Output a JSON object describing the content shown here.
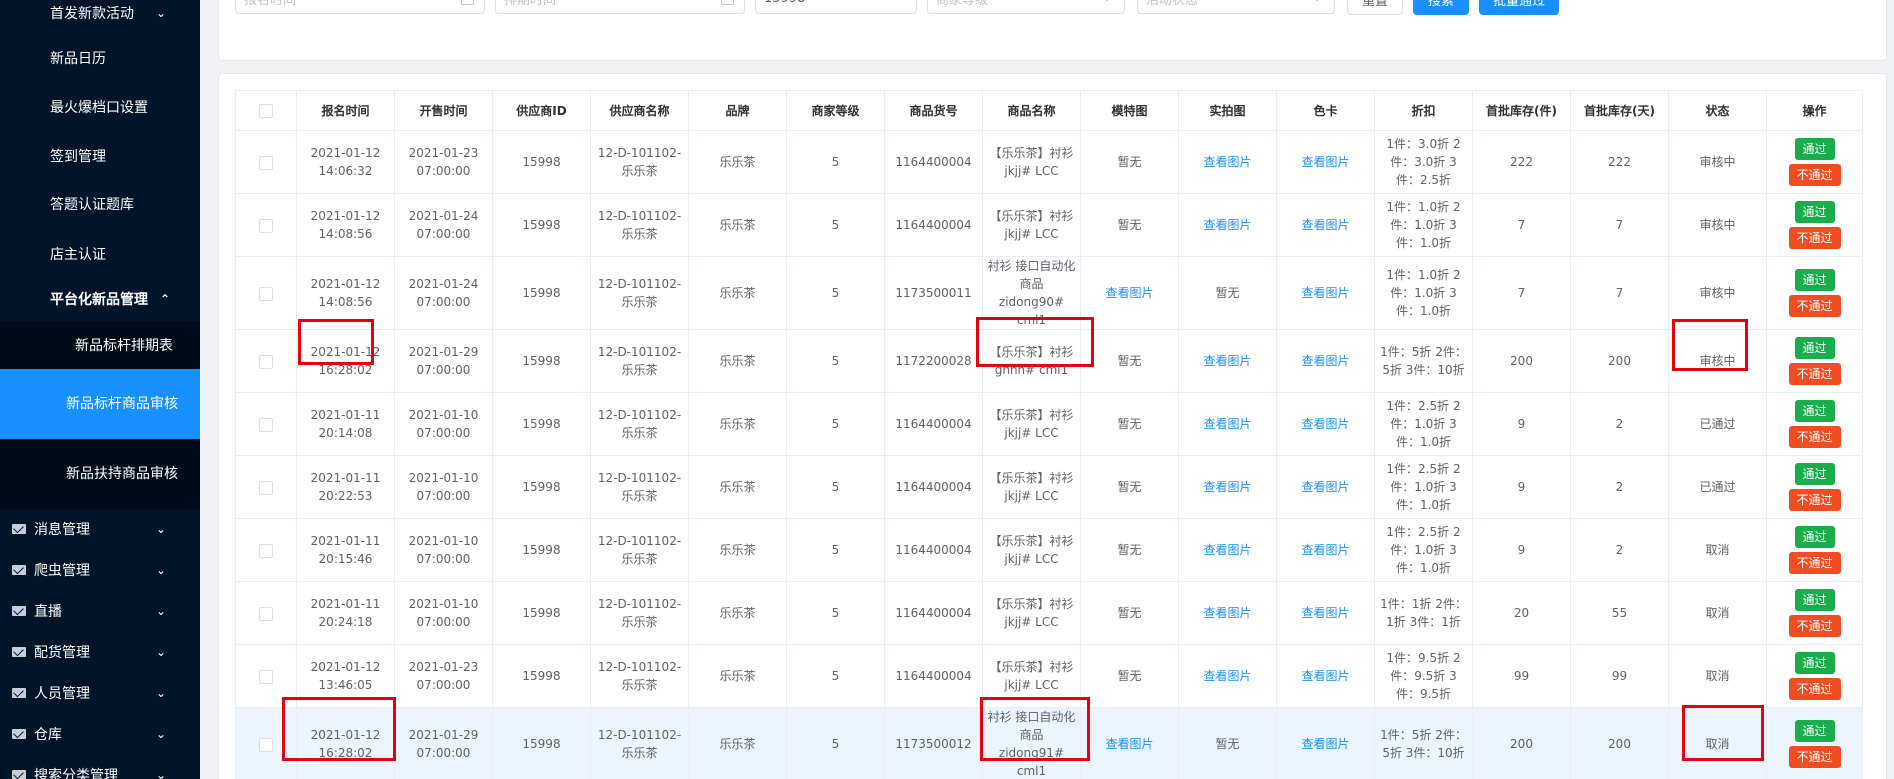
{
  "sidebar": {
    "items": [
      {
        "label": "首发新款活动",
        "chevron": "⌄"
      },
      {
        "label": "新品日历"
      },
      {
        "label": "最火爆档口设置"
      },
      {
        "label": "签到管理"
      },
      {
        "label": "答题认证题库"
      },
      {
        "label": "店主认证"
      },
      {
        "label": "平台化新品管理",
        "chevron": "⌃"
      },
      {
        "label": "新品标杆排期表"
      },
      {
        "label": "新品标杆商品审核"
      },
      {
        "label": "新品扶持商品审核"
      },
      {
        "label": "消息管理",
        "chevron": "⌄"
      },
      {
        "label": "爬虫管理",
        "chevron": "⌄"
      },
      {
        "label": "直播",
        "chevron": "⌄"
      },
      {
        "label": "配货管理",
        "chevron": "⌄"
      },
      {
        "label": "人员管理",
        "chevron": "⌄"
      },
      {
        "label": "仓库",
        "chevron": "⌄"
      },
      {
        "label": "搜索分类管理",
        "chevron": "⌄"
      }
    ]
  },
  "filters": {
    "signup_time_placeholder": "报名时间",
    "schedule_time_placeholder": "排期时间",
    "supplier_id_value": "15998",
    "merchant_level_placeholder": "商家等级",
    "activity_status_placeholder": "活动状态",
    "reset_label": "重置",
    "search_label": "搜索",
    "batch_pass_label": "批量通过"
  },
  "table": {
    "headers": [
      "报名时间",
      "开售时间",
      "供应商ID",
      "供应商名称",
      "品牌",
      "商家等级",
      "商品货号",
      "商品名称",
      "模特图",
      "实拍图",
      "色卡",
      "折扣",
      "首批库存(件)",
      "首批库存(天)",
      "状态",
      "操作"
    ],
    "pass_label": "通过",
    "fail_label": "不通过",
    "rows": [
      {
        "signup": "2021-01-12 14:06:32",
        "sale": "2021-01-23 07:00:00",
        "sid": "15998",
        "sname": "12-D-101102-乐乐茶",
        "brand": "乐乐茶",
        "level": "5",
        "sku": "1164400004",
        "pname": "【乐乐茶】衬衫jkjj# LCC",
        "model": "暂无",
        "real": "查看图片",
        "color": "查看图片",
        "discount": "1件：3.0折 2件：3.0折 3件：2.5折",
        "stock_qty": "222",
        "stock_days": "222",
        "status": "审核中"
      },
      {
        "signup": "2021-01-12 14:08:56",
        "sale": "2021-01-24 07:00:00",
        "sid": "15998",
        "sname": "12-D-101102-乐乐茶",
        "brand": "乐乐茶",
        "level": "5",
        "sku": "1164400004",
        "pname": "【乐乐茶】衬衫jkjj# LCC",
        "model": "暂无",
        "real": "查看图片",
        "color": "查看图片",
        "discount": "1件：1.0折 2件：1.0折 3件：1.0折",
        "stock_qty": "7",
        "stock_days": "7",
        "status": "审核中"
      },
      {
        "signup": "2021-01-12 14:08:56",
        "sale": "2021-01-24 07:00:00",
        "sid": "15998",
        "sname": "12-D-101102-乐乐茶",
        "brand": "乐乐茶",
        "level": "5",
        "sku": "1173500011",
        "pname": "衬衫 接口自动化商品 zidong90# cml1",
        "model": "查看图片",
        "real": "暂无",
        "color": "查看图片",
        "discount": "1件：1.0折 2件：1.0折 3件：1.0折",
        "stock_qty": "7",
        "stock_days": "7",
        "status": "审核中"
      },
      {
        "signup": "2021-01-12 16:28:02",
        "sale": "2021-01-29 07:00:00",
        "sid": "15998",
        "sname": "12-D-101102-乐乐茶",
        "brand": "乐乐茶",
        "level": "5",
        "sku": "1172200028",
        "pname": "【乐乐茶】衬衫gnnn# cml1",
        "model": "暂无",
        "real": "查看图片",
        "color": "查看图片",
        "discount": "1件：5折 2件：5折 3件：10折",
        "stock_qty": "200",
        "stock_days": "200",
        "status": "审核中"
      },
      {
        "signup": "2021-01-11 20:14:08",
        "sale": "2021-01-10 07:00:00",
        "sid": "15998",
        "sname": "12-D-101102-乐乐茶",
        "brand": "乐乐茶",
        "level": "5",
        "sku": "1164400004",
        "pname": "【乐乐茶】衬衫jkjj# LCC",
        "model": "暂无",
        "real": "查看图片",
        "color": "查看图片",
        "discount": "1件：2.5折 2件：1.0折 3件：1.0折",
        "stock_qty": "9",
        "stock_days": "2",
        "status": "已通过"
      },
      {
        "signup": "2021-01-11 20:22:53",
        "sale": "2021-01-10 07:00:00",
        "sid": "15998",
        "sname": "12-D-101102-乐乐茶",
        "brand": "乐乐茶",
        "level": "5",
        "sku": "1164400004",
        "pname": "【乐乐茶】衬衫jkjj# LCC",
        "model": "暂无",
        "real": "查看图片",
        "color": "查看图片",
        "discount": "1件：2.5折 2件：1.0折 3件：1.0折",
        "stock_qty": "9",
        "stock_days": "2",
        "status": "已通过"
      },
      {
        "signup": "2021-01-11 20:15:46",
        "sale": "2021-01-10 07:00:00",
        "sid": "15998",
        "sname": "12-D-101102-乐乐茶",
        "brand": "乐乐茶",
        "level": "5",
        "sku": "1164400004",
        "pname": "【乐乐茶】衬衫jkjj# LCC",
        "model": "暂无",
        "real": "查看图片",
        "color": "查看图片",
        "discount": "1件：2.5折 2件：1.0折 3件：1.0折",
        "stock_qty": "9",
        "stock_days": "2",
        "status": "取消"
      },
      {
        "signup": "2021-01-11 20:24:18",
        "sale": "2021-01-10 07:00:00",
        "sid": "15998",
        "sname": "12-D-101102-乐乐茶",
        "brand": "乐乐茶",
        "level": "5",
        "sku": "1164400004",
        "pname": "【乐乐茶】衬衫jkjj# LCC",
        "model": "暂无",
        "real": "查看图片",
        "color": "查看图片",
        "discount": "1件：1折 2件：1折 3件：1折",
        "stock_qty": "20",
        "stock_days": "55",
        "status": "取消"
      },
      {
        "signup": "2021-01-12 13:46:05",
        "sale": "2021-01-23 07:00:00",
        "sid": "15998",
        "sname": "12-D-101102-乐乐茶",
        "brand": "乐乐茶",
        "level": "5",
        "sku": "1164400004",
        "pname": "【乐乐茶】衬衫jkjj# LCC",
        "model": "暂无",
        "real": "查看图片",
        "color": "查看图片",
        "discount": "1件：9.5折 2件：9.5折 3件：9.5折",
        "stock_qty": "99",
        "stock_days": "99",
        "status": "取消"
      },
      {
        "signup": "2021-01-12 16:28:02",
        "sale": "2021-01-29 07:00:00",
        "sid": "15998",
        "sname": "12-D-101102-乐乐茶",
        "brand": "乐乐茶",
        "level": "5",
        "sku": "1173500012",
        "pname": "衬衫 接口自动化商品 zidong91# cml1",
        "model": "查看图片",
        "real": "暂无",
        "color": "查看图片",
        "discount": "1件：5折 2件：5折 3件：10折",
        "stock_qty": "200",
        "stock_days": "200",
        "status": "取消"
      }
    ]
  }
}
